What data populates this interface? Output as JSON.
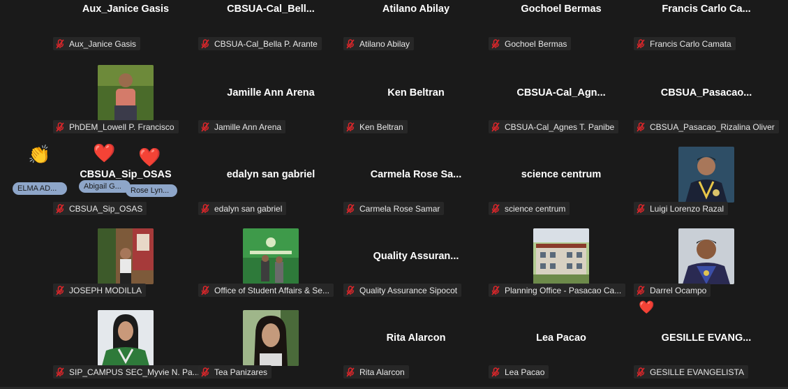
{
  "colors": {
    "background": "#1a1a1a",
    "mic_muted": "#e0262a",
    "nametag_bg": "#282828",
    "reaction_name_bg": "#8ea6c9"
  },
  "grid": [
    {
      "display": "Aux_Janice Gasis",
      "tag": "Aux_Janice Gasis"
    },
    {
      "display": "CBSUA-Cal_Bell...",
      "tag": "CBSUA-Cal_Bella P. Arante"
    },
    {
      "display": "Atilano Abilay",
      "tag": "Atilano Abilay"
    },
    {
      "display": "Gochoel Bermas",
      "tag": "Gochoel Bermas"
    },
    {
      "display": "Francis  Carlo  Ca...",
      "tag": "Francis Carlo Camata"
    },
    {
      "display": "",
      "tag": "PhDEM_Lowell P. Francisco",
      "photo": "man-outdoor-photo"
    },
    {
      "display": "Jamille Ann Arena",
      "tag": "Jamille Ann Arena"
    },
    {
      "display": "Ken Beltran",
      "tag": "Ken Beltran"
    },
    {
      "display": "CBSUA-Cal_Agn...",
      "tag": "CBSUA-Cal_Agnes T. Panibe"
    },
    {
      "display": "CBSUA_Pasacao...",
      "tag": "CBSUA_Pasacao_Rizalina Oliver"
    },
    {
      "display": "CBSUA_Sip_OSAS",
      "tag": "CBSUA_Sip_OSAS"
    },
    {
      "display": "edalyn san gabriel",
      "tag": "edalyn san gabriel"
    },
    {
      "display": "Carmela Rose  Sa...",
      "tag": "Carmela Rose Samar"
    },
    {
      "display": "science centrum",
      "tag": "science centrum"
    },
    {
      "display": "",
      "tag": "Luigi Lorenzo Razal",
      "photo": "graduate-man-photo"
    },
    {
      "display": "",
      "tag": "JOSEPH MODILLA",
      "photo": "man-booth-photo"
    },
    {
      "display": "",
      "tag": "Office of Student Affairs & Se...",
      "photo": "banner-photo"
    },
    {
      "display": "Quality  Assuran...",
      "tag": "Quality Assurance Sipocot"
    },
    {
      "display": "",
      "tag": "Planning Office - Pasacao Ca...",
      "photo": "building-photo"
    },
    {
      "display": "",
      "tag": "Darrel Ocampo",
      "photo": "graduate-man2-photo"
    },
    {
      "display": "",
      "tag": "SIP_CAMPUS SEC_Myvie N. Pa...",
      "photo": "graduate-woman-photo"
    },
    {
      "display": "",
      "tag": "Tea Panizares",
      "photo": "woman-selfie-photo"
    },
    {
      "display": "Rita Alarcon",
      "tag": "Rita Alarcon"
    },
    {
      "display": "Lea Pacao",
      "tag": "Lea Pacao"
    },
    {
      "display": "GESILLE  EVANG...",
      "tag": "GESILLE EVANGELISTA"
    }
  ],
  "reactions": {
    "clap": {
      "emoji": "👏",
      "name": "ELMA  AD..."
    },
    "heart1": {
      "emoji": "❤️",
      "name": "Abigail  G..."
    },
    "heart2": {
      "emoji": "❤️",
      "name": "Rose  Lyn..."
    },
    "heart3": {
      "emoji": "❤️"
    }
  }
}
